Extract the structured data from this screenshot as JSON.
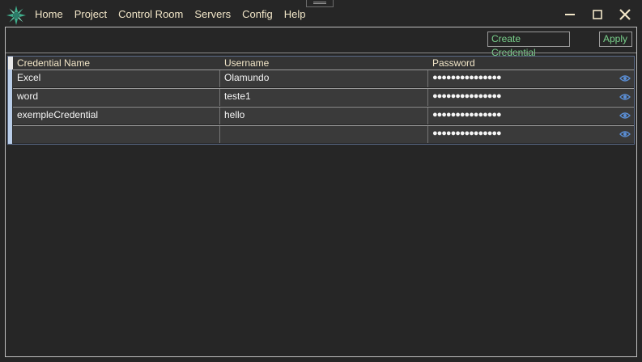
{
  "menu": {
    "items": [
      "Home",
      "Project",
      "Control Room",
      "Servers",
      "Config",
      "Help"
    ]
  },
  "toolbar": {
    "create_label": "Create Credential",
    "apply_label": "Apply"
  },
  "grid": {
    "columns": [
      "Credential Name",
      "Username",
      "Password"
    ],
    "rows": [
      {
        "name": "Excel",
        "username": "Olamundo",
        "password": "●●●●●●●●●●●●●●●"
      },
      {
        "name": "word",
        "username": "teste1",
        "password": "●●●●●●●●●●●●●●●"
      },
      {
        "name": "exempleCredential",
        "username": "hello",
        "password": "●●●●●●●●●●●●●●●"
      },
      {
        "name": "",
        "username": "",
        "password": "●●●●●●●●●●●●●●●"
      }
    ]
  },
  "colors": {
    "background": "#262626",
    "menu_text": "#f2e6c8",
    "button_text": "#7ad18c",
    "eye_icon": "#5b8fd6"
  },
  "icons": {
    "logo": "app-logo-icon",
    "minimize": "minimize-icon",
    "maximize": "maximize-icon",
    "close": "close-icon",
    "reveal": "eye-icon"
  }
}
